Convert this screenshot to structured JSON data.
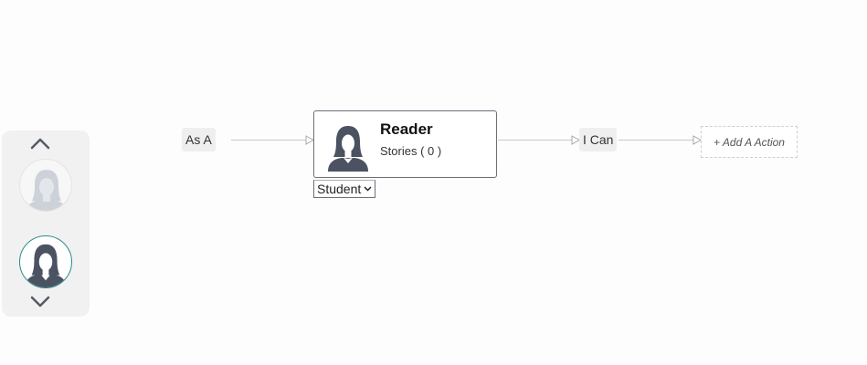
{
  "picker": {
    "up_icon": "chevron-up-icon",
    "down_icon": "chevron-down-icon",
    "avatars": [
      {
        "name": "persona-avatar-inactive",
        "icon": "female-user-icon",
        "state": "inactive"
      },
      {
        "name": "persona-avatar-active",
        "icon": "female-user-icon",
        "state": "active"
      }
    ],
    "active_ring_color": "#2e8b8b"
  },
  "flow": {
    "as_a_label": "As A",
    "card": {
      "title": "Reader",
      "subtitle": "Stories ( 0 )",
      "icon": "female-user-icon"
    },
    "role_select": {
      "value": "Student",
      "icon": "chevron-down-icon"
    },
    "i_can_label": "I Can",
    "add_action_label": "+ Add A Action"
  },
  "colors": {
    "connector": "#c8c8c8",
    "arrow_head": "#a9a9a9",
    "card_border": "#6b6f78",
    "silhouette_dark": "#4b5262",
    "silhouette_light": "#cdd1d8"
  }
}
